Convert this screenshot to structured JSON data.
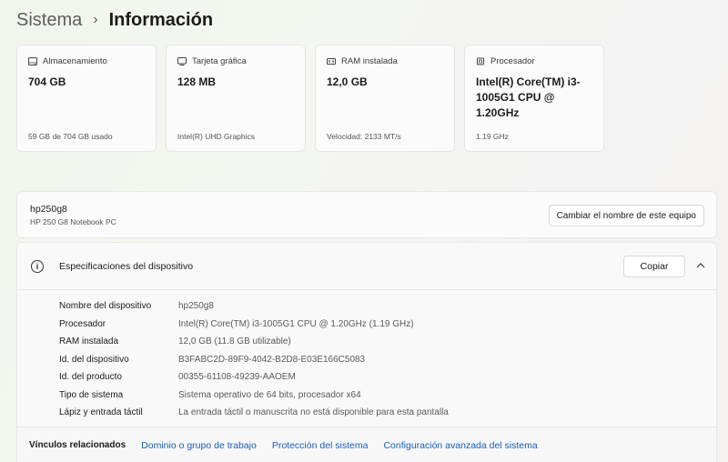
{
  "breadcrumb": {
    "parent": "Sistema",
    "separator": "›",
    "current": "Información"
  },
  "cards": [
    {
      "icon": "storage-icon",
      "label": "Almacenamiento",
      "value": "704 GB",
      "sub": "59 GB de 704 GB usado"
    },
    {
      "icon": "graphics-card-icon",
      "label": "Tarjeta gráfica",
      "value": "128 MB",
      "sub": "Intel(R) UHD Graphics"
    },
    {
      "icon": "ram-icon",
      "label": "RAM instalada",
      "value": "12,0 GB",
      "sub": "Velocidad: 2133 MT/s"
    },
    {
      "icon": "processor-icon",
      "label": "Procesador",
      "value": "Intel(R) Core(TM) i3-1005G1 CPU @ 1.20GHz",
      "sub": "1.19 GHz"
    }
  ],
  "device": {
    "name": "hp250g8",
    "model": "HP 250 G8 Notebook PC",
    "rename_label": "Cambiar el nombre de este equipo"
  },
  "specs": {
    "title": "Especificaciones del dispositivo",
    "copy_label": "Copiar",
    "rows": [
      {
        "label": "Nombre del dispositivo",
        "value": "hp250g8"
      },
      {
        "label": "Procesador",
        "value": "Intel(R) Core(TM) i3-1005G1 CPU @ 1.20GHz (1.19 GHz)"
      },
      {
        "label": "RAM instalada",
        "value": "12,0 GB (11.8 GB utilizable)"
      },
      {
        "label": "Id. del dispositivo",
        "value": "B3FABC2D-89F9-4042-B2D8-E03E166C5083"
      },
      {
        "label": "Id. del producto",
        "value": "00355-61108-49239-AAOEM"
      },
      {
        "label": "Tipo de sistema",
        "value": "Sistema operativo de 64 bits, procesador x64"
      },
      {
        "label": "Lápiz y entrada táctil",
        "value": "La entrada táctil o manuscrita no está disponible para esta pantalla"
      }
    ]
  },
  "related": {
    "title": "Vínculos relacionados",
    "links": [
      "Dominio o grupo de trabajo",
      "Protección del sistema",
      "Configuración avanzada del sistema"
    ]
  },
  "colors": {
    "link": "#1a5fb4"
  }
}
